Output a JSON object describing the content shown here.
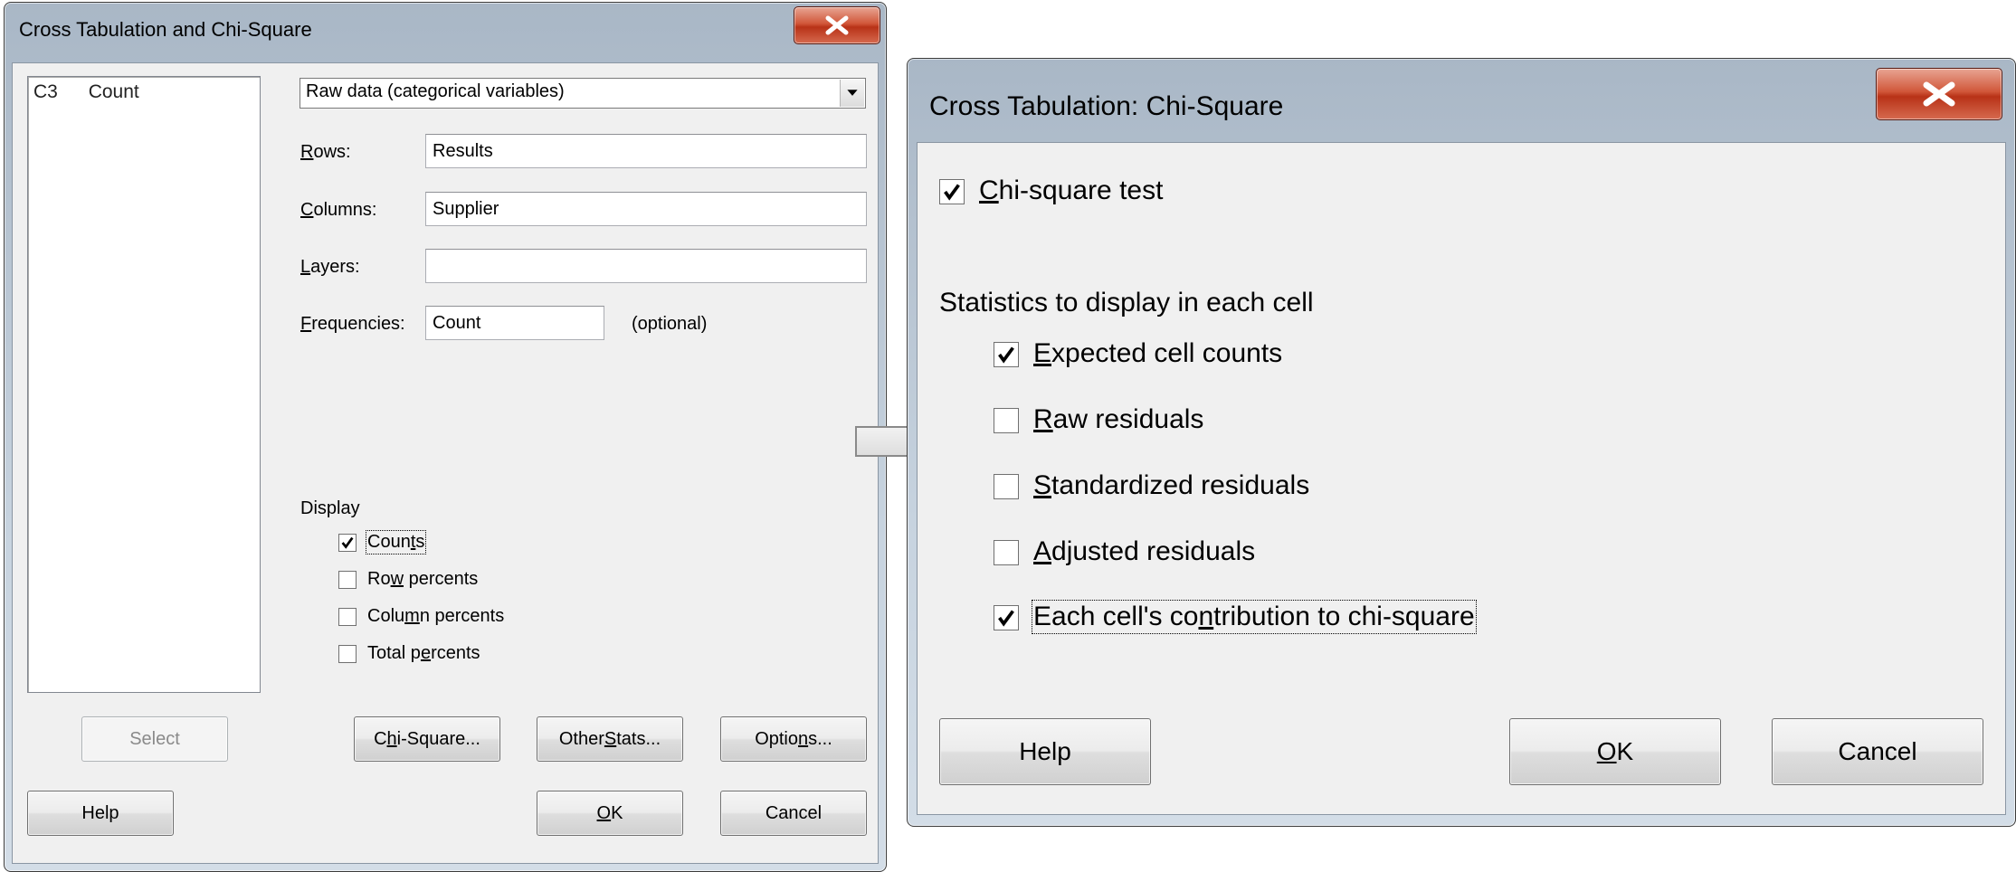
{
  "dialog1": {
    "title": "Cross Tabulation and Chi-Square",
    "variables": [
      {
        "column": "C3",
        "name": "Count"
      }
    ],
    "data_type": {
      "selected": "Raw data (categorical variables)"
    },
    "rows": {
      "label_u": "R",
      "label_rest": "ows:",
      "value": "Results"
    },
    "columns": {
      "label_u": "C",
      "label_rest": "olumns:",
      "value": "Supplier"
    },
    "layers": {
      "label_u": "L",
      "label_rest": "ayers:",
      "value": ""
    },
    "frequencies": {
      "label_u": "F",
      "label_rest": "requencies:",
      "value": "Count",
      "note": "(optional)"
    },
    "display": {
      "heading": "Display",
      "options": [
        {
          "pre": "Coun",
          "u": "t",
          "post": "s",
          "checked": true
        },
        {
          "pre": "Ro",
          "u": "w",
          "post": " percents",
          "checked": false
        },
        {
          "pre": "Colu",
          "u": "m",
          "post": "n percents",
          "checked": false
        },
        {
          "pre": "Total p",
          "u": "e",
          "post": "rcents",
          "checked": false
        }
      ]
    },
    "buttons": {
      "select": "Select",
      "chi_pre": "C",
      "chi_u": "h",
      "chi_post": "i-Square...",
      "other_pre": "Other ",
      "other_u": "S",
      "other_post": "tats...",
      "options_pre": "Optio",
      "options_u": "n",
      "options_post": "s...",
      "help": "Help",
      "ok_u": "O",
      "ok_post": "K",
      "cancel": "Cancel"
    }
  },
  "dialog2": {
    "title": "Cross Tabulation: Chi-Square",
    "chi_test": {
      "u": "C",
      "post": "hi-square test",
      "checked": true
    },
    "stats_heading": "Statistics to display in each cell",
    "stats": [
      {
        "u": "E",
        "post": "xpected cell counts",
        "checked": true
      },
      {
        "u": "R",
        "post": "aw residuals",
        "checked": false
      },
      {
        "u": "S",
        "post": "tandardized residuals",
        "checked": false
      },
      {
        "u": "A",
        "post": "djusted residuals",
        "checked": false
      },
      {
        "pre": "Each cell's co",
        "u": "n",
        "post": "tribution to chi-square",
        "checked": true
      }
    ],
    "buttons": {
      "help": "Help",
      "ok_u": "O",
      "ok_post": "K",
      "cancel": "Cancel"
    }
  },
  "icons": {
    "close": "close-x-icon",
    "dropdown": "chevron-down-icon",
    "arrow": "right-arrow-icon",
    "check": "checkmark-icon"
  }
}
